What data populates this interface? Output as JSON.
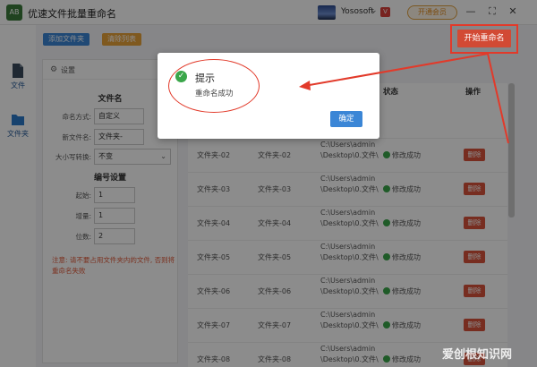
{
  "app": {
    "title": "优速文件批量重命名",
    "logo_text": "AB"
  },
  "user": {
    "name": "Yososoft",
    "vip": "V",
    "open_member": "开通会员"
  },
  "window": {
    "minimize": "—",
    "maximize": "⛶",
    "close": "✕"
  },
  "nav": [
    {
      "label": "文件"
    },
    {
      "label": "文件夹"
    }
  ],
  "toolbar": {
    "add_folder": "添加文件夹",
    "clear_list": "清除列表",
    "start_rename": "开始重命名",
    "add_color": "#3b86d6",
    "clear_color": "#e8a23a",
    "start_color": "#d24a34"
  },
  "settings": {
    "header": "设置",
    "section_file_name": "文件名",
    "naming_mode_label": "命名方式:",
    "naming_mode_value": "自定义",
    "new_name_label": "新文件名:",
    "new_name_value": "文件夹-",
    "case_label": "大小写转换:",
    "case_value": "不变",
    "section_number": "编号设置",
    "start_label": "起始:",
    "start_value": "1",
    "step_label": "增量:",
    "step_value": "1",
    "digits_label": "位数:",
    "digits_value": "2",
    "note": "注意: 请不要占用文件夹内的文件, 否则将重命名失败"
  },
  "table": {
    "headers": {
      "status": "状态",
      "action": "操作"
    },
    "rows": [
      {
        "original": "文件夹-02",
        "new": "文件夹-02",
        "path": "C:\\Users\\admin\\Desktop\\0.文件\\",
        "status": "修改成功",
        "action": "删除"
      },
      {
        "original": "文件夹-03",
        "new": "文件夹-03",
        "path": "C:\\Users\\admin\\Desktop\\0.文件\\",
        "status": "修改成功",
        "action": "删除"
      },
      {
        "original": "文件夹-04",
        "new": "文件夹-04",
        "path": "C:\\Users\\admin\\Desktop\\0.文件\\",
        "status": "修改成功",
        "action": "删除"
      },
      {
        "original": "文件夹-05",
        "new": "文件夹-05",
        "path": "C:\\Users\\admin\\Desktop\\0.文件\\",
        "status": "修改成功",
        "action": "删除"
      },
      {
        "original": "文件夹-06",
        "new": "文件夹-06",
        "path": "C:\\Users\\admin\\Desktop\\0.文件\\",
        "status": "修改成功",
        "action": "删除"
      },
      {
        "original": "文件夹-07",
        "new": "文件夹-07",
        "path": "C:\\Users\\admin\\Desktop\\0.文件\\",
        "status": "修改成功",
        "action": "删除"
      },
      {
        "original": "文件夹-08",
        "new": "文件夹-08",
        "path": "C:\\Users\\admin\\Desktop\\0.文件\\",
        "status": "修改成功",
        "action": "删除"
      }
    ]
  },
  "dialog": {
    "title": "提示",
    "message": "重命名成功",
    "confirm": "确定"
  },
  "watermark": "爱创根知识网"
}
